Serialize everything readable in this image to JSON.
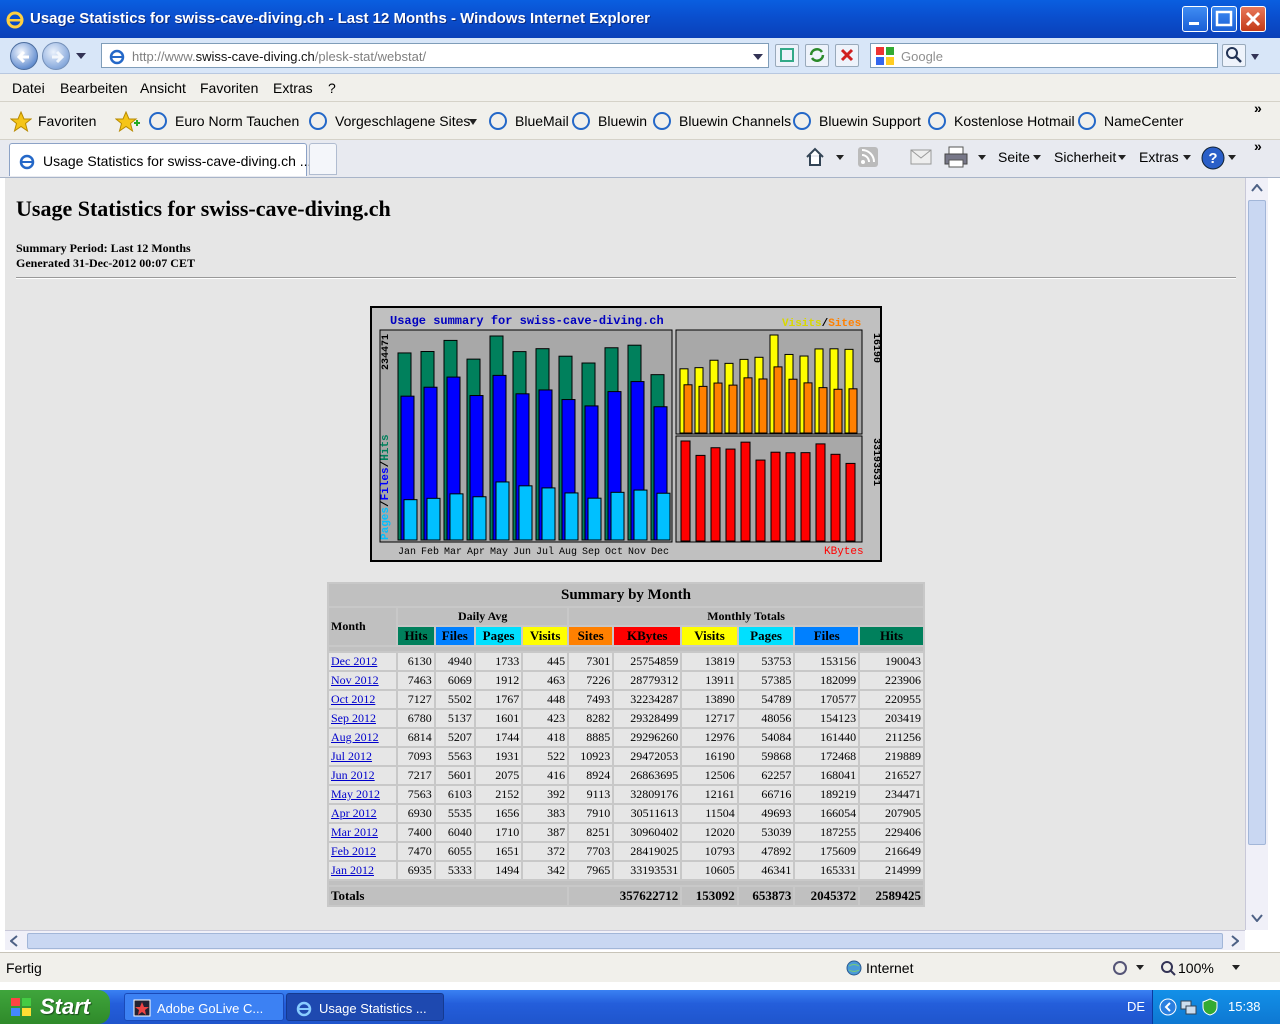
{
  "window": {
    "title": "Usage Statistics for swiss-cave-diving.ch - Last 12 Months - Windows Internet Explorer"
  },
  "address": {
    "url_prefix": "http://www.",
    "url_host": "swiss-cave-diving.ch",
    "url_path": "/plesk-stat/webstat/",
    "search_placeholder": "Google"
  },
  "menu": [
    "Datei",
    "Bearbeiten",
    "Ansicht",
    "Favoriten",
    "Extras",
    "?"
  ],
  "favorites": {
    "label": "Favoriten",
    "items": [
      "Euro Norm Tauchen",
      "Vorgeschlagene Sites",
      "BlueMail",
      "Bluewin",
      "Bluewin Channels",
      "Bluewin Support",
      "Kostenlose Hotmail",
      "NameCenter"
    ]
  },
  "tab": {
    "label": "Usage Statistics for swiss-cave-diving.ch ..."
  },
  "commands": {
    "page": "Seite",
    "security": "Sicherheit",
    "tools": "Extras"
  },
  "page": {
    "title": "Usage Statistics for swiss-cave-diving.ch",
    "summary_period": "Summary Period: Last 12 Months",
    "generated": "Generated 31-Dec-2012 00:07 CET"
  },
  "graph": {
    "title": "Usage summary for swiss-cave-diving.ch",
    "legend_visits": "Visits",
    "legend_sep": "/",
    "legend_sites": "Sites",
    "left_axis_max": "234471",
    "right_top_max": "16190",
    "right_bottom_max": "33193531",
    "left_label_pages": "Pages",
    "left_label_files": "Files",
    "left_label_hits": "Hits",
    "kbytes_label": "KBytes",
    "colors": {
      "hits": "#00805c",
      "files": "#0000ff",
      "pages": "#00c0ff",
      "visits": "#ffff00",
      "sites": "#ff8000",
      "kbytes": "#ff0000"
    }
  },
  "chart_data": {
    "type": "bar",
    "title": "Usage summary for swiss-cave-diving.ch",
    "categories": [
      "Jan",
      "Feb",
      "Mar",
      "Apr",
      "May",
      "Jun",
      "Jul",
      "Aug",
      "Sep",
      "Oct",
      "Nov",
      "Dec"
    ],
    "series": [
      {
        "name": "Hits",
        "values": [
          214999,
          216649,
          229406,
          207905,
          234471,
          216527,
          219889,
          211256,
          203419,
          220955,
          223906,
          190043
        ]
      },
      {
        "name": "Files",
        "values": [
          165331,
          175609,
          187255,
          166054,
          189219,
          168041,
          172468,
          161440,
          154123,
          170577,
          182099,
          153156
        ]
      },
      {
        "name": "Pages",
        "values": [
          46341,
          47892,
          53039,
          49693,
          66716,
          62257,
          59868,
          54084,
          48056,
          54789,
          57385,
          53753
        ]
      },
      {
        "name": "Visits",
        "values": [
          10605,
          10793,
          12020,
          11504,
          12161,
          12506,
          16190,
          12976,
          12717,
          13890,
          13911,
          13819
        ]
      },
      {
        "name": "Sites",
        "values": [
          7965,
          7703,
          8251,
          7910,
          9113,
          8924,
          10923,
          8885,
          8282,
          7493,
          7226,
          7301
        ]
      },
      {
        "name": "KBytes",
        "values": [
          33193531,
          28419025,
          30960402,
          30511613,
          32809176,
          26863695,
          29472053,
          29296260,
          29328499,
          32234287,
          28779312,
          25754859
        ]
      }
    ]
  },
  "table": {
    "caption": "Summary by Month",
    "month_header": "Month",
    "daily_avg": "Daily Avg",
    "monthly_totals": "Monthly Totals",
    "col_daily": [
      "Hits",
      "Files",
      "Pages",
      "Visits"
    ],
    "col_monthly": [
      "Sites",
      "KBytes",
      "Visits",
      "Pages",
      "Files",
      "Hits"
    ],
    "col_colors_daily": [
      "#00805c",
      "#0080ff",
      "#00e0ff",
      "#ffff00"
    ],
    "col_colors_monthly": [
      "#ff8000",
      "#ff0000",
      "#ffff00",
      "#00e0ff",
      "#0080ff",
      "#00805c"
    ],
    "rows": [
      [
        "Dec 2012",
        "6130",
        "4940",
        "1733",
        "445",
        "7301",
        "25754859",
        "13819",
        "53753",
        "153156",
        "190043"
      ],
      [
        "Nov 2012",
        "7463",
        "6069",
        "1912",
        "463",
        "7226",
        "28779312",
        "13911",
        "57385",
        "182099",
        "223906"
      ],
      [
        "Oct 2012",
        "7127",
        "5502",
        "1767",
        "448",
        "7493",
        "32234287",
        "13890",
        "54789",
        "170577",
        "220955"
      ],
      [
        "Sep 2012",
        "6780",
        "5137",
        "1601",
        "423",
        "8282",
        "29328499",
        "12717",
        "48056",
        "154123",
        "203419"
      ],
      [
        "Aug 2012",
        "6814",
        "5207",
        "1744",
        "418",
        "8885",
        "29296260",
        "12976",
        "54084",
        "161440",
        "211256"
      ],
      [
        "Jul 2012",
        "7093",
        "5563",
        "1931",
        "522",
        "10923",
        "29472053",
        "16190",
        "59868",
        "172468",
        "219889"
      ],
      [
        "Jun 2012",
        "7217",
        "5601",
        "2075",
        "416",
        "8924",
        "26863695",
        "12506",
        "62257",
        "168041",
        "216527"
      ],
      [
        "May 2012",
        "7563",
        "6103",
        "2152",
        "392",
        "9113",
        "32809176",
        "12161",
        "66716",
        "189219",
        "234471"
      ],
      [
        "Apr 2012",
        "6930",
        "5535",
        "1656",
        "383",
        "7910",
        "30511613",
        "11504",
        "49693",
        "166054",
        "207905"
      ],
      [
        "Mar 2012",
        "7400",
        "6040",
        "1710",
        "387",
        "8251",
        "30960402",
        "12020",
        "53039",
        "187255",
        "229406"
      ],
      [
        "Feb 2012",
        "7470",
        "6055",
        "1651",
        "372",
        "7703",
        "28419025",
        "10793",
        "47892",
        "175609",
        "216649"
      ],
      [
        "Jan 2012",
        "6935",
        "5333",
        "1494",
        "342",
        "7965",
        "33193531",
        "10605",
        "46341",
        "165331",
        "214999"
      ]
    ],
    "totals_label": "Totals",
    "totals": [
      "357622712",
      "153092",
      "653873",
      "2045372",
      "2589425"
    ]
  },
  "status": {
    "left": "Fertig",
    "zone": "Internet",
    "zoom": "100%"
  },
  "taskbar": {
    "start": "Start",
    "buttons": [
      "Adobe GoLive C...",
      "Usage Statistics ..."
    ],
    "lang": "DE",
    "clock": "15:38"
  }
}
